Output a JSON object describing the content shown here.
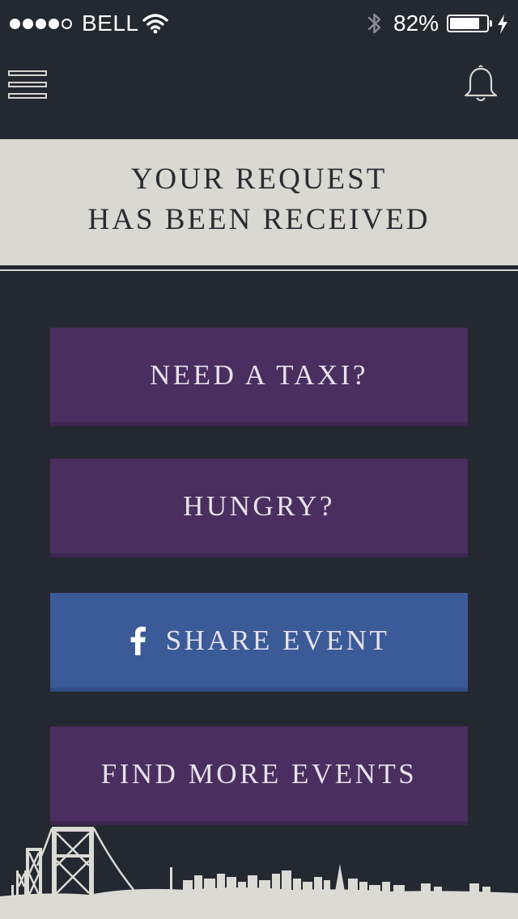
{
  "status_bar": {
    "carrier": "BELL",
    "battery_percent_label": "82%",
    "battery_level": 0.82,
    "signal_bars_filled": 4,
    "signal_bars_total": 5,
    "icons": [
      "signal-dots-icon",
      "wifi-icon",
      "bluetooth-icon",
      "battery-icon",
      "charging-bolt-icon"
    ]
  },
  "nav": {
    "left_icon": "hamburger-menu-icon",
    "right_icon": "bell-icon"
  },
  "banner": {
    "line1": "YOUR REQUEST",
    "line2": "HAS BEEN RECEIVED"
  },
  "actions": {
    "taxi_label": "NEED A TAXI?",
    "hungry_label": "HUNGRY?",
    "share_label": "SHARE EVENT",
    "share_icon": "facebook-icon",
    "more_events_label": "FIND MORE EVENTS"
  },
  "decor": {
    "footer_image": "city-skyline-bridge-icon"
  },
  "colors": {
    "background": "#242830",
    "banner": "#dad8d3",
    "banner_text": "#2a2c33",
    "purple_button": "#4a2e5f",
    "facebook_blue": "#3b5a98",
    "button_text": "#e6e2ea",
    "skyline": "#dcdad5"
  }
}
